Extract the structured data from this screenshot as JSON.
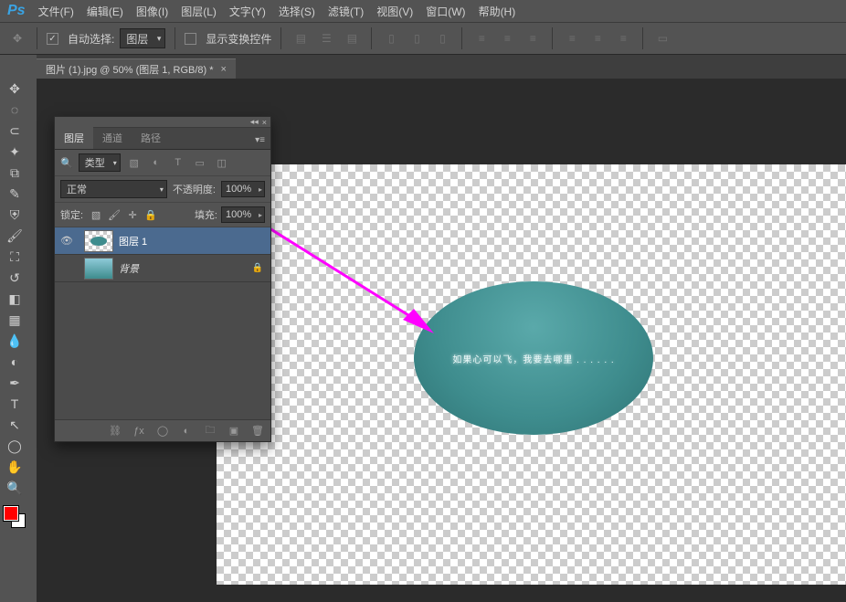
{
  "menu": {
    "items": [
      "文件(F)",
      "编辑(E)",
      "图像(I)",
      "图层(L)",
      "文字(Y)",
      "选择(S)",
      "滤镜(T)",
      "视图(V)",
      "窗口(W)",
      "帮助(H)"
    ]
  },
  "options": {
    "auto_select_label": "自动选择:",
    "auto_select_target": "图层",
    "show_transform_label": "显示变换控件"
  },
  "doc_tab": {
    "title": "图片 (1).jpg @ 50% (图层 1, RGB/8) *"
  },
  "panel": {
    "tabs": [
      "图层",
      "通道",
      "路径"
    ],
    "filter_label": "类型",
    "blend_mode": "正常",
    "opacity_label": "不透明度:",
    "opacity_value": "100%",
    "lock_label": "锁定:",
    "fill_label": "填充:",
    "fill_value": "100%",
    "layers": [
      {
        "name": "图层 1",
        "visible": true,
        "selected": true,
        "locked": false,
        "thumb": "oval"
      },
      {
        "name": "背景",
        "visible": false,
        "selected": false,
        "locked": true,
        "thumb": "bg"
      }
    ]
  },
  "canvas": {
    "oval_text": "如果心可以飞，我要去哪里 . . . . . ."
  }
}
